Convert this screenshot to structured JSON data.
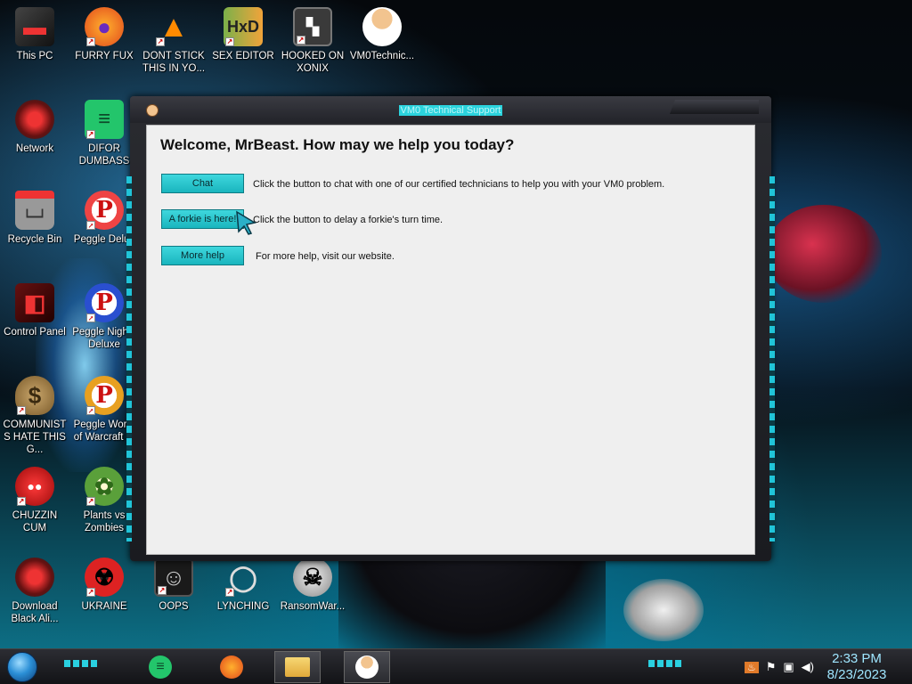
{
  "desktop": {
    "icons": [
      {
        "label": "This PC"
      },
      {
        "label": "FURRY FUX"
      },
      {
        "label": "DONT STICK THIS IN YO..."
      },
      {
        "label": "SEX EDITOR"
      },
      {
        "label": "HOOKED ON XONIX"
      },
      {
        "label": "VM0Technic..."
      },
      {
        "label": "Network"
      },
      {
        "label": "DIFOR DUMBASS"
      },
      {
        "label": "Recycle Bin"
      },
      {
        "label": "Peggle Delux"
      },
      {
        "label": "Control Panel"
      },
      {
        "label": "Peggle Nights Deluxe"
      },
      {
        "label": "COMMUNISTS HATE THIS G..."
      },
      {
        "label": "Peggle World of Warcraft ..."
      },
      {
        "label": "CHUZZIN CUM"
      },
      {
        "label": "Plants vs Zombies"
      },
      {
        "label": "Download Black Ali..."
      },
      {
        "label": "UKRAINE"
      },
      {
        "label": "OOPS"
      },
      {
        "label": "LYNCHING"
      },
      {
        "label": "RansomWar..."
      }
    ]
  },
  "window": {
    "title": "VM0 Technical Support",
    "heading": "Welcome, MrBeast. How may we help you today?",
    "rows": [
      {
        "button": "Chat",
        "description": "Click the button to chat with one of our certified technicians to help you with your VM0 problem."
      },
      {
        "button": "A forkie is here!",
        "description": "Click the button to delay a forkie's turn time."
      },
      {
        "button": "More help",
        "description": "For more help, visit our website."
      }
    ]
  },
  "taskbar": {
    "pinned": [
      "green-notes-icon",
      "firefox-icon",
      "file-explorer-icon",
      "vm0-support-icon"
    ],
    "clock_time": "2:33 PM",
    "clock_date": "8/23/2023"
  },
  "colors": {
    "accent": "#1fb4e6",
    "button": "#2bc8d0",
    "title_text": "#5ee5ee"
  }
}
